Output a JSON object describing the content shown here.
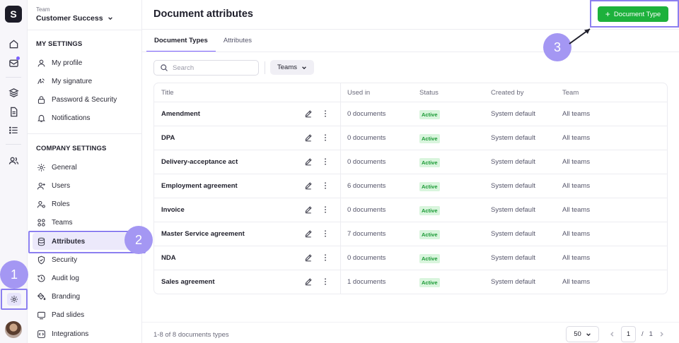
{
  "app": {
    "logo_letter": "S"
  },
  "sidebar": {
    "team_label": "Team",
    "team_name": "Customer Success",
    "my_settings_heading": "MY SETTINGS",
    "my_items": [
      "My profile",
      "My signature",
      "Password & Security",
      "Notifications"
    ],
    "company_heading": "COMPANY SETTINGS",
    "company_items": [
      "General",
      "Users",
      "Roles",
      "Teams",
      "Attributes",
      "Security",
      "Audit log",
      "Branding",
      "Pad slides",
      "Integrations"
    ]
  },
  "header": {
    "title": "Document attributes",
    "add_button": "Document Type"
  },
  "tabs": [
    "Document Types",
    "Attributes"
  ],
  "toolbar": {
    "search_placeholder": "Search",
    "teams_filter": "Teams"
  },
  "table": {
    "columns": [
      "Title",
      "Used in",
      "Status",
      "Created by",
      "Team"
    ],
    "rows": [
      {
        "title": "Amendment",
        "used_in": "0 documents",
        "status": "Active",
        "created_by": "System default",
        "team": "All teams"
      },
      {
        "title": "DPA",
        "used_in": "0 documents",
        "status": "Active",
        "created_by": "System default",
        "team": "All teams"
      },
      {
        "title": "Delivery-acceptance act",
        "used_in": "0 documents",
        "status": "Active",
        "created_by": "System default",
        "team": "All teams"
      },
      {
        "title": "Employment agreement",
        "used_in": "6 documents",
        "status": "Active",
        "created_by": "System default",
        "team": "All teams"
      },
      {
        "title": "Invoice",
        "used_in": "0 documents",
        "status": "Active",
        "created_by": "System default",
        "team": "All teams"
      },
      {
        "title": "Master Service agreement",
        "used_in": "7 documents",
        "status": "Active",
        "created_by": "System default",
        "team": "All teams"
      },
      {
        "title": "NDA",
        "used_in": "0 documents",
        "status": "Active",
        "created_by": "System default",
        "team": "All teams"
      },
      {
        "title": "Sales agreement",
        "used_in": "1 documents",
        "status": "Active",
        "created_by": "System default",
        "team": "All teams"
      }
    ]
  },
  "footer": {
    "count": "1-8 of 8 documents types",
    "per_page": "50",
    "current_page": "1",
    "page_sep": "/",
    "total_pages": "1"
  },
  "callouts": [
    "1",
    "2",
    "3"
  ],
  "colors": {
    "accent": "#7b61ff",
    "primary_button": "#1db13c",
    "callout": "#a497f3",
    "active_badge_bg": "#d9f5dd",
    "active_badge_text": "#1a9a35"
  }
}
